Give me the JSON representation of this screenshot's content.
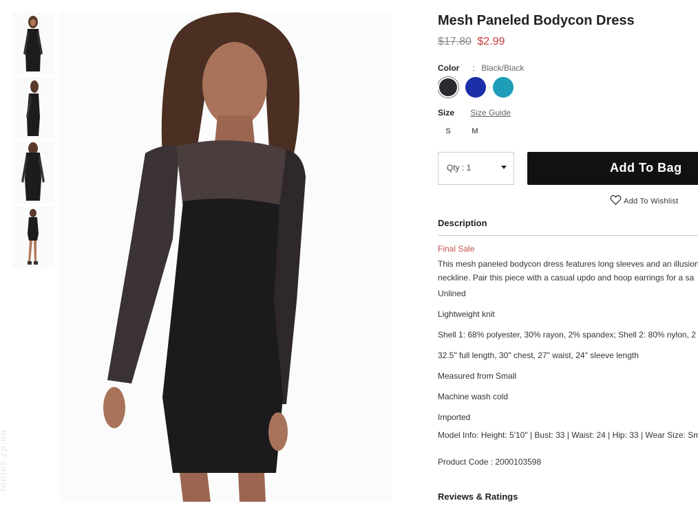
{
  "product": {
    "title": "Mesh Paneled Bodycon Dress",
    "price_original": "$17.80",
    "price_sale": "$2.99"
  },
  "color": {
    "label": "Color",
    "separator": ":",
    "selected_name": "Black/Black",
    "swatches": [
      {
        "name": "black-swatch",
        "hex": "#2b2a2e"
      },
      {
        "name": "blue-swatch",
        "hex": "#1a2fa8"
      },
      {
        "name": "teal-swatch",
        "hex": "#1d9db7"
      }
    ]
  },
  "size": {
    "label": "Size",
    "guide_label": "Size Guide",
    "options": [
      "S",
      "M"
    ]
  },
  "purchase": {
    "qty_label": "Qty : 1",
    "add_to_bag_label": "Add To Bag",
    "wishlist_label": "Add To Wishlist"
  },
  "description": {
    "heading": "Description",
    "final_sale": "Final Sale",
    "text_line1": "This mesh paneled bodycon dress features long sleeves and an illusion",
    "text_line2": "neckline. Pair this piece with a casual updo and hoop earrings for a sa",
    "specs": [
      "Unlined",
      "Lightweight knit",
      "Shell 1: 68% polyester, 30% rayon, 2% spandex; Shell 2: 80% nylon, 2",
      "32.5\" full length, 30\" chest, 27\" waist, 24\" sleeve length",
      "Measured from Small",
      "Machine wash cold",
      "Imported",
      "Model Info: Height: 5'10\" | Bust: 33 | Waist: 24 | Hip: 33 | Wear Size: Sm"
    ],
    "product_code": "Product Code : 2000103598"
  },
  "reviews": {
    "heading": "Reviews & Ratings"
  },
  "watermark": "ladies.zp.ua",
  "colors": {
    "sale_red": "#c43b3b",
    "final_sale": "#c0504d",
    "button_black": "#111111"
  }
}
